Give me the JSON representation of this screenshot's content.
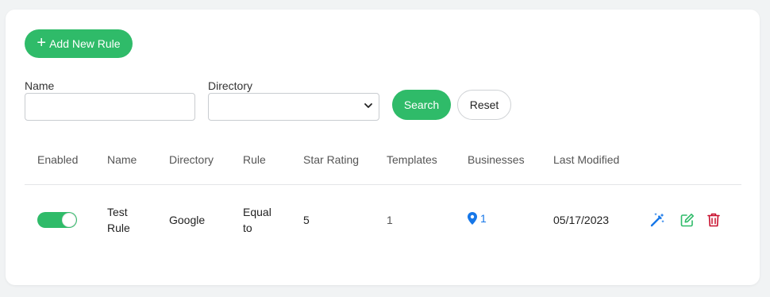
{
  "toolbar": {
    "add_label": "Add New Rule"
  },
  "filters": {
    "name_label": "Name",
    "name_value": "",
    "directory_label": "Directory",
    "directory_value": "",
    "search_label": "Search",
    "reset_label": "Reset"
  },
  "table": {
    "headers": [
      "Enabled",
      "Name",
      "Directory",
      "Rule",
      "Star Rating",
      "Templates",
      "Businesses",
      "Last Modified"
    ],
    "rows": [
      {
        "enabled": true,
        "name": "Test Rule",
        "directory": "Google",
        "rule": "Equal to",
        "star_rating": "5",
        "templates": "1",
        "businesses": "1",
        "last_modified": "05/17/2023"
      }
    ]
  },
  "icons": {
    "add": "plus-icon",
    "select": "chevron-down-icon",
    "businesses": "map-pin-icon",
    "actions": [
      "magic-wand-icon",
      "edit-icon",
      "trash-icon"
    ]
  },
  "colors": {
    "primary": "#2fbb69",
    "link": "#1677e8",
    "danger": "#c8102e",
    "background": "#f1f3f4"
  }
}
